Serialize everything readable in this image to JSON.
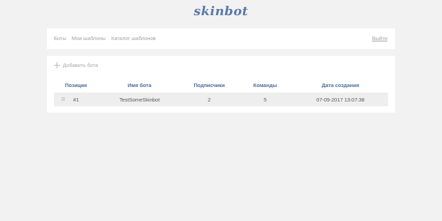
{
  "brand": {
    "logo_text": "skinbot"
  },
  "nav": {
    "items": [
      {
        "label": "Боты"
      },
      {
        "label": "Мои шаблоны"
      },
      {
        "label": "Каталог шаблонов"
      }
    ],
    "logout_label": "Выйти"
  },
  "panel": {
    "add_bot_label": "Добавить бота",
    "add_icon": "plus-icon",
    "table": {
      "headers": [
        "Позиция",
        "Имя бота",
        "Подписчики",
        "Команды",
        "Дата создания"
      ],
      "rows": [
        {
          "position": "#1",
          "name": "TestSomeSkinbot",
          "subscribers": "2",
          "commands": "5",
          "created": "07-09-2017 13:07:38",
          "drag_icon": "drag-handle-icon"
        }
      ]
    }
  },
  "colors": {
    "background": "#f2f2f2",
    "brand": "#5a78a8",
    "header_text": "#4a6a9a",
    "row_background": "#eeeeee"
  }
}
